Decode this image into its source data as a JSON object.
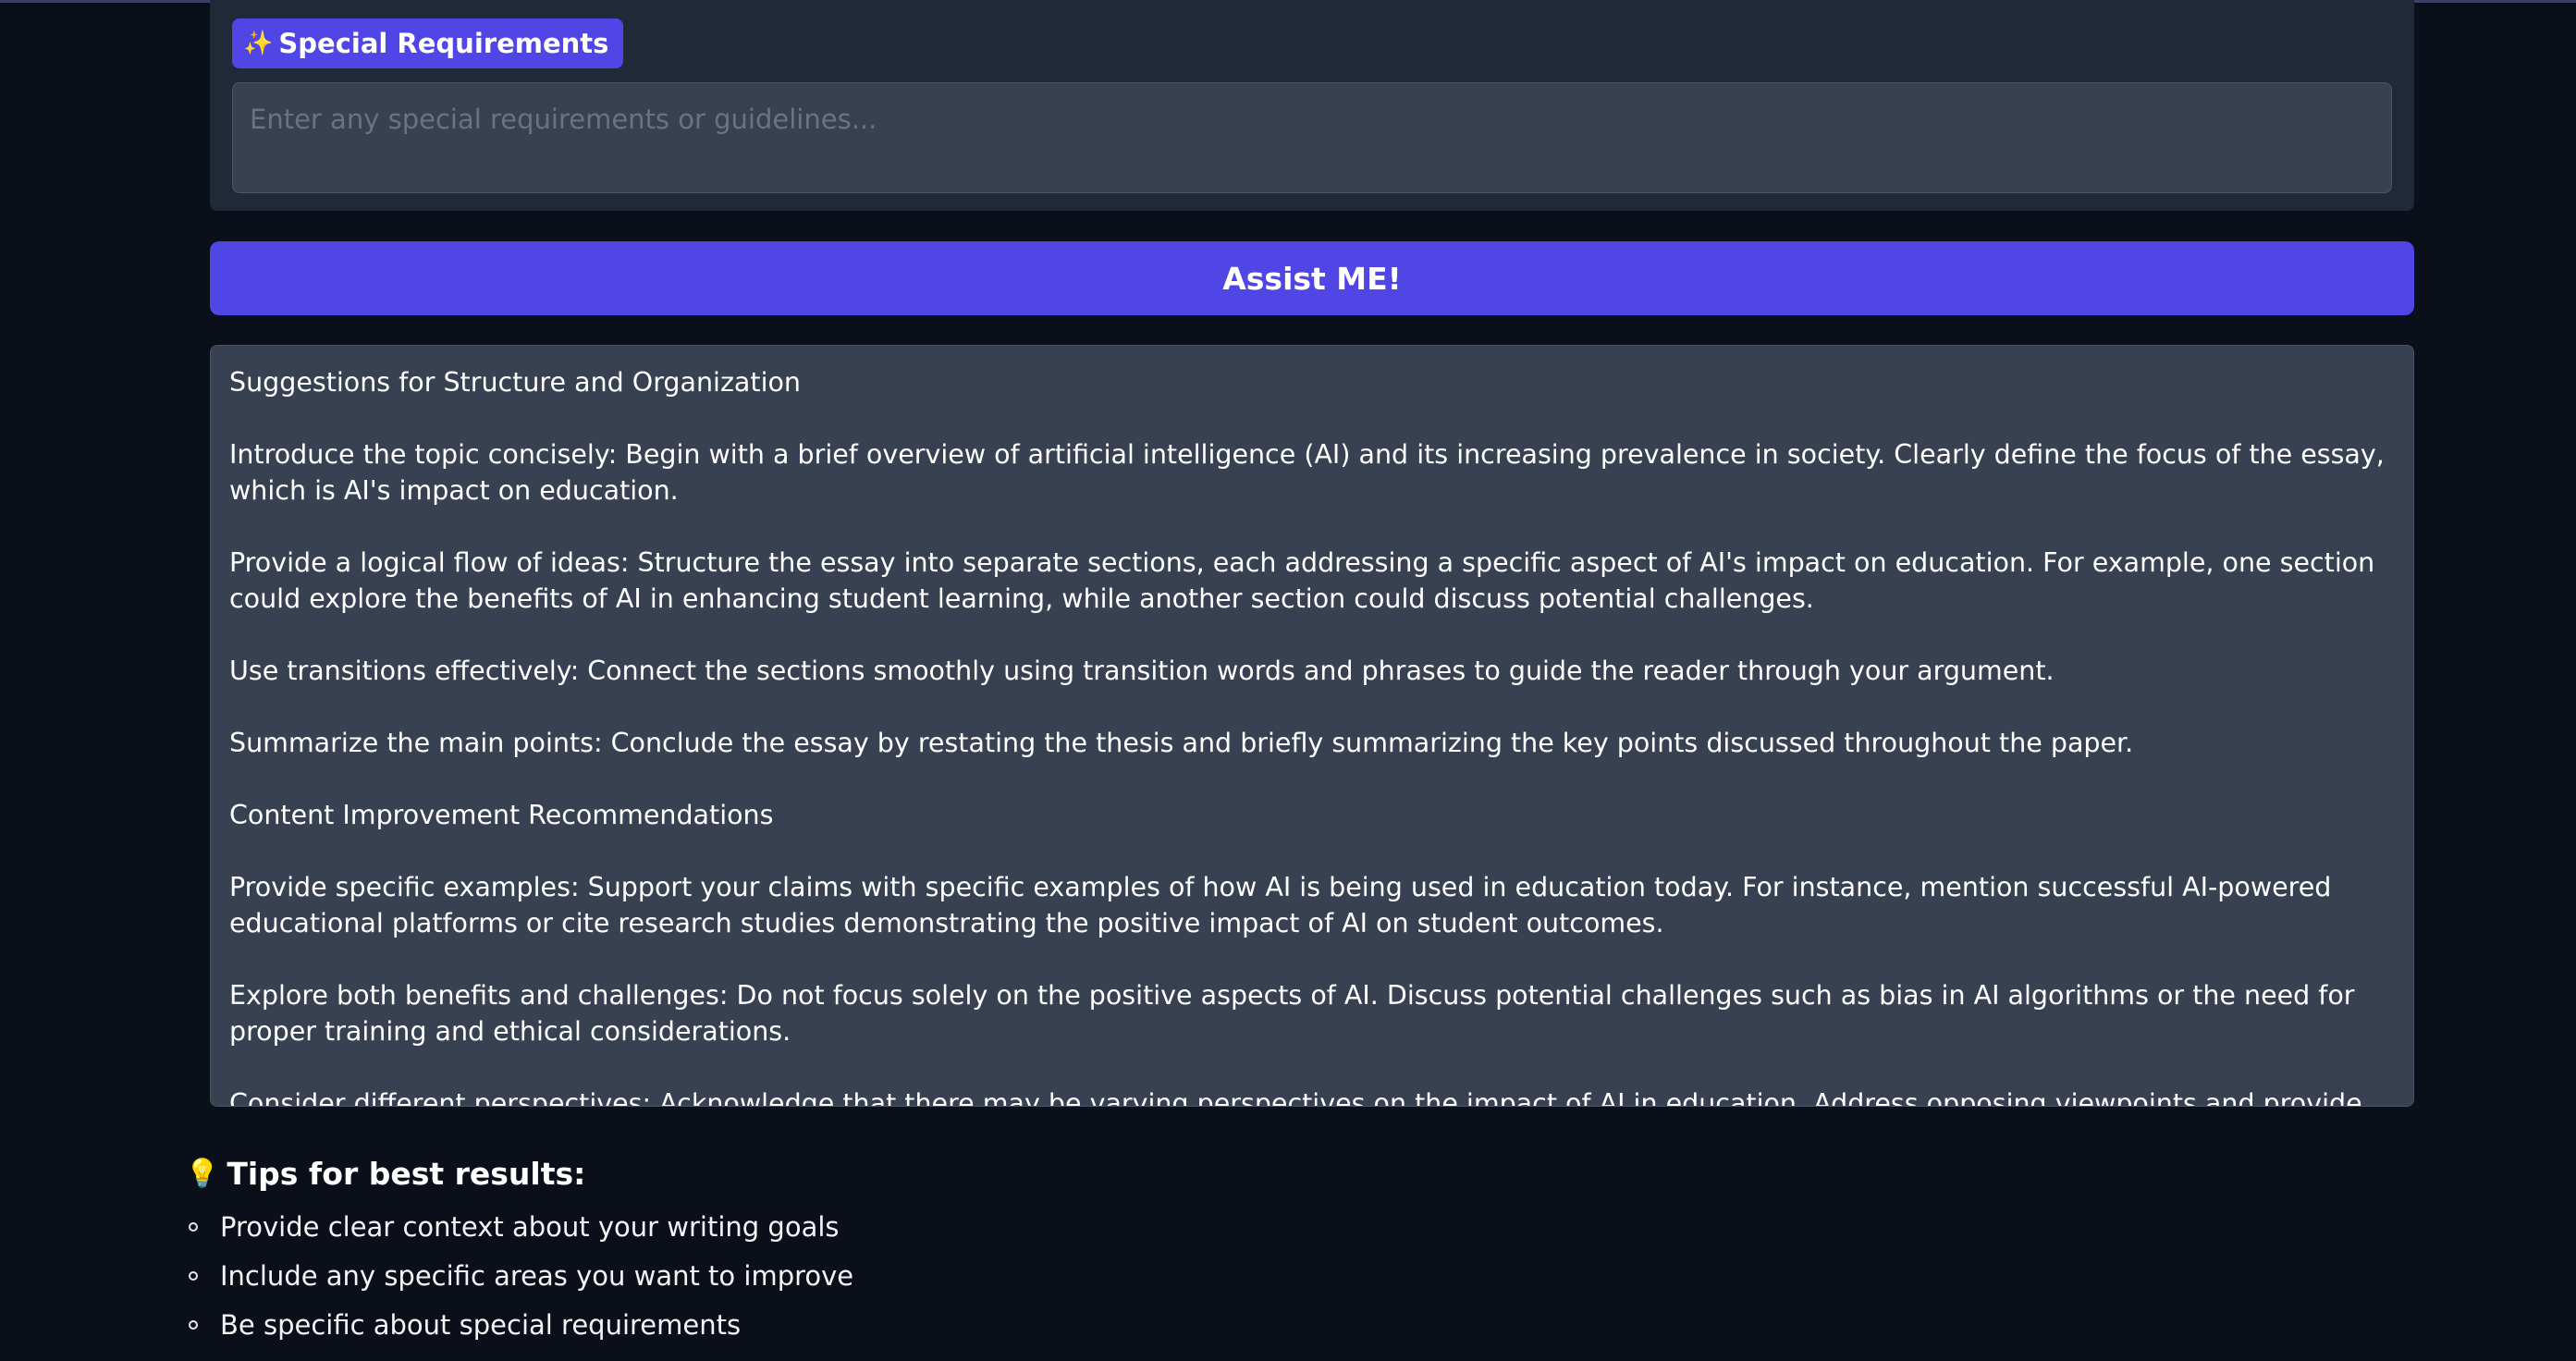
{
  "special_requirements": {
    "label_icon": "✨",
    "label": "Special Requirements",
    "placeholder": "Enter any special requirements or guidelines...",
    "value": ""
  },
  "assist_button": {
    "label": "Assist ME!"
  },
  "output": {
    "paragraphs": [
      "Suggestions for Structure and Organization",
      "Introduce the topic concisely: Begin with a brief overview of artificial intelligence (AI) and its increasing prevalence in society. Clearly define the focus of the essay, which is AI's impact on education.",
      "Provide a logical flow of ideas: Structure the essay into separate sections, each addressing a specific aspect of AI's impact on education. For example, one section could explore the benefits of AI in enhancing student learning, while another section could discuss potential challenges.",
      "Use transitions effectively: Connect the sections smoothly using transition words and phrases to guide the reader through your argument.",
      "Summarize the main points: Conclude the essay by restating the thesis and briefly summarizing the key points discussed throughout the paper.",
      "Content Improvement Recommendations",
      "Provide specific examples: Support your claims with specific examples of how AI is being used in education today. For instance, mention successful AI-powered educational platforms or cite research studies demonstrating the positive impact of AI on student outcomes.",
      "Explore both benefits and challenges: Do not focus solely on the positive aspects of AI. Discuss potential challenges such as bias in AI algorithms or the need for proper training and ethical considerations.",
      "Consider different perspectives: Acknowledge that there may be varying perspectives on the impact of AI in education. Address opposing viewpoints and provide"
    ]
  },
  "tips": {
    "icon": "💡",
    "heading": "Tips for best results:",
    "items": [
      "Provide clear context about your writing goals",
      "Include any specific areas you want to improve",
      "Be specific about special requirements"
    ]
  },
  "colors": {
    "background": "#0b0f19",
    "panel": "#1f2937",
    "input": "#374151",
    "accent": "#4f46e5"
  }
}
